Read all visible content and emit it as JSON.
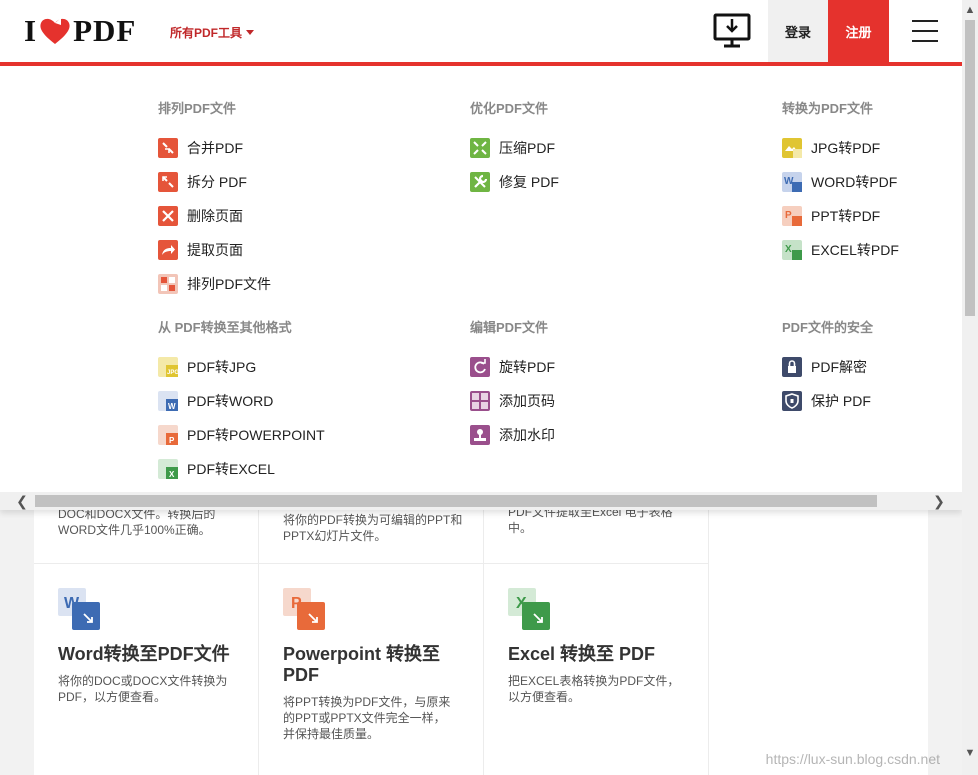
{
  "header": {
    "logo_left": "I",
    "logo_right": "PDF",
    "tools_menu_label": "所有PDF工具",
    "login_label": "登录",
    "signup_label": "注册"
  },
  "menu": {
    "arrange": {
      "title": "排列PDF文件",
      "items": [
        {
          "label": "合并PDF",
          "icon": "merge-icon",
          "color": "#e5553a"
        },
        {
          "label": "拆分 PDF",
          "icon": "split-icon",
          "color": "#e5553a"
        },
        {
          "label": "删除页面",
          "icon": "delete-page-icon",
          "color": "#e5553a"
        },
        {
          "label": "提取页面",
          "icon": "extract-page-icon",
          "color": "#e5553a"
        },
        {
          "label": "排列PDF文件",
          "icon": "organize-icon",
          "color": "#e5553a"
        }
      ]
    },
    "optimize": {
      "title": "优化PDF文件",
      "items": [
        {
          "label": "压缩PDF",
          "icon": "compress-icon",
          "color": "#6fb543"
        },
        {
          "label": "修复 PDF",
          "icon": "repair-icon",
          "color": "#6fb543"
        }
      ]
    },
    "convert_to": {
      "title": "转换为PDF文件",
      "items": [
        {
          "label": "JPG转PDF",
          "icon": "jpg-to-pdf-icon",
          "color": "#e0c532"
        },
        {
          "label": "WORD转PDF",
          "icon": "word-to-pdf-icon",
          "color": "#3d6bb3"
        },
        {
          "label": "PPT转PDF",
          "icon": "ppt-to-pdf-icon",
          "color": "#e86a3a"
        },
        {
          "label": "EXCEL转PDF",
          "icon": "excel-to-pdf-icon",
          "color": "#3e9a4a"
        }
      ]
    },
    "convert_from": {
      "title": "从 PDF转换至其他格式",
      "items": [
        {
          "label": "PDF转JPG",
          "icon": "pdf-to-jpg-icon",
          "color": "#e0c532"
        },
        {
          "label": "PDF转WORD",
          "icon": "pdf-to-word-icon",
          "color": "#3d6bb3"
        },
        {
          "label": "PDF转POWERPOINT",
          "icon": "pdf-to-powerpoint-icon",
          "color": "#e86a3a"
        },
        {
          "label": "PDF转EXCEL",
          "icon": "pdf-to-excel-icon",
          "color": "#3e9a4a"
        }
      ]
    },
    "edit": {
      "title": "编辑PDF文件",
      "items": [
        {
          "label": "旋转PDF",
          "icon": "rotate-icon",
          "color": "#9a4f8c"
        },
        {
          "label": "添加页码",
          "icon": "page-numbers-icon",
          "color": "#9a4f8c"
        },
        {
          "label": "添加水印",
          "icon": "watermark-icon",
          "color": "#9a4f8c"
        }
      ]
    },
    "security": {
      "title": "PDF文件的安全",
      "items": [
        {
          "label": "PDF解密",
          "icon": "unlock-icon",
          "color": "#3e4a6a"
        },
        {
          "label": "保护 PDF",
          "icon": "shield-icon",
          "color": "#3e4a6a"
        }
      ]
    }
  },
  "cards_top": [
    {
      "desc": "DOC和DOCX文件。转换后的WORD文件几乎100%正确。"
    },
    {
      "desc": "将你的PDF转换为可编辑的PPT和PPTX幻灯片文件。"
    },
    {
      "desc": "PDF文件提取至Excel 电子表格中。"
    }
  ],
  "cards": [
    {
      "title": "Word转换至PDF文件",
      "desc": "将你的DOC或DOCX文件转换为PDF，以方便查看。",
      "icon": "word-icon",
      "letter": "W",
      "color": "#3d6bb3"
    },
    {
      "title": "Powerpoint 转换至PDF",
      "desc": "将PPT转换为PDF文件，与原来的PPT或PPTX文件完全一样，并保持最佳质量。",
      "icon": "powerpoint-icon",
      "letter": "P",
      "color": "#e86a3a"
    },
    {
      "title": "Excel 转换至 PDF",
      "desc": "把EXCEL表格转换为PDF文件，以方便查看。",
      "icon": "excel-icon",
      "letter": "X",
      "color": "#3e9a4a"
    }
  ],
  "watermark": "https://lux-sun.blog.csdn.net"
}
